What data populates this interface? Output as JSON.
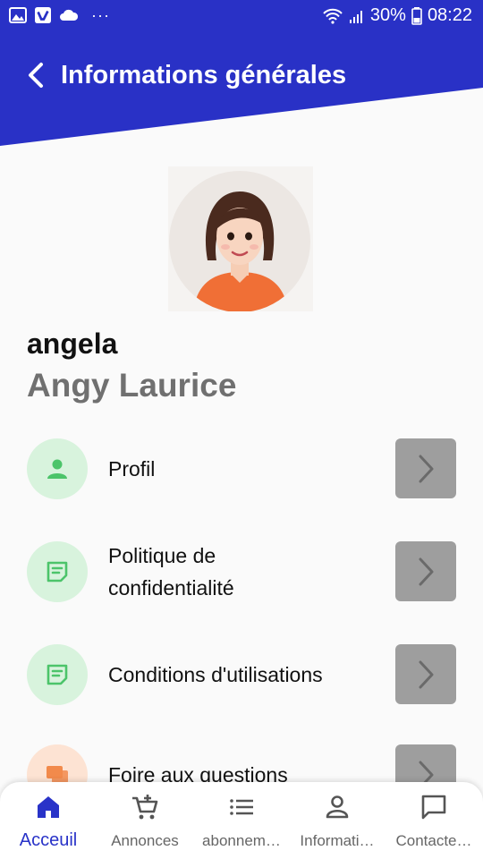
{
  "colors": {
    "header": "#2931c6",
    "active": "#2933c8",
    "green_bg": "#d8f3dd",
    "green_icon": "#4cc46a",
    "orange_bg": "#fde3d3",
    "orange_icon": "#f28a4b",
    "arrow_box": "#9e9e9e"
  },
  "status_bar": {
    "battery": "30%",
    "time": "08:22",
    "left_icons": [
      "gallery-icon",
      "vimeo-icon",
      "cloud-icon",
      "more-dots-icon"
    ],
    "right_icons": [
      "wifi-icon",
      "signal-icon",
      "battery-icon"
    ]
  },
  "header": {
    "title": "Informations générales",
    "back_icon": "chevron-left-icon"
  },
  "profile": {
    "username": "angela",
    "full_name": "Angy Laurice"
  },
  "menu": [
    {
      "label": "Profil",
      "icon": "person-icon",
      "variant": "green"
    },
    {
      "label": "Politique de confidentialité",
      "icon": "note-icon",
      "variant": "green"
    },
    {
      "label": "Conditions d'utilisations",
      "icon": "note-icon",
      "variant": "green"
    },
    {
      "label": "Foire aux questions",
      "icon": "forum-icon",
      "variant": "orange"
    }
  ],
  "bottom_nav": [
    {
      "label": "Acceuil",
      "icon": "home-icon",
      "active": true
    },
    {
      "label": "Annonces",
      "icon": "cart-add-icon",
      "active": false
    },
    {
      "label": "abonnem…",
      "icon": "list-icon",
      "active": false
    },
    {
      "label": "Informati…",
      "icon": "person-outline-icon",
      "active": false
    },
    {
      "label": "Contacte…",
      "icon": "chat-icon",
      "active": false
    }
  ]
}
